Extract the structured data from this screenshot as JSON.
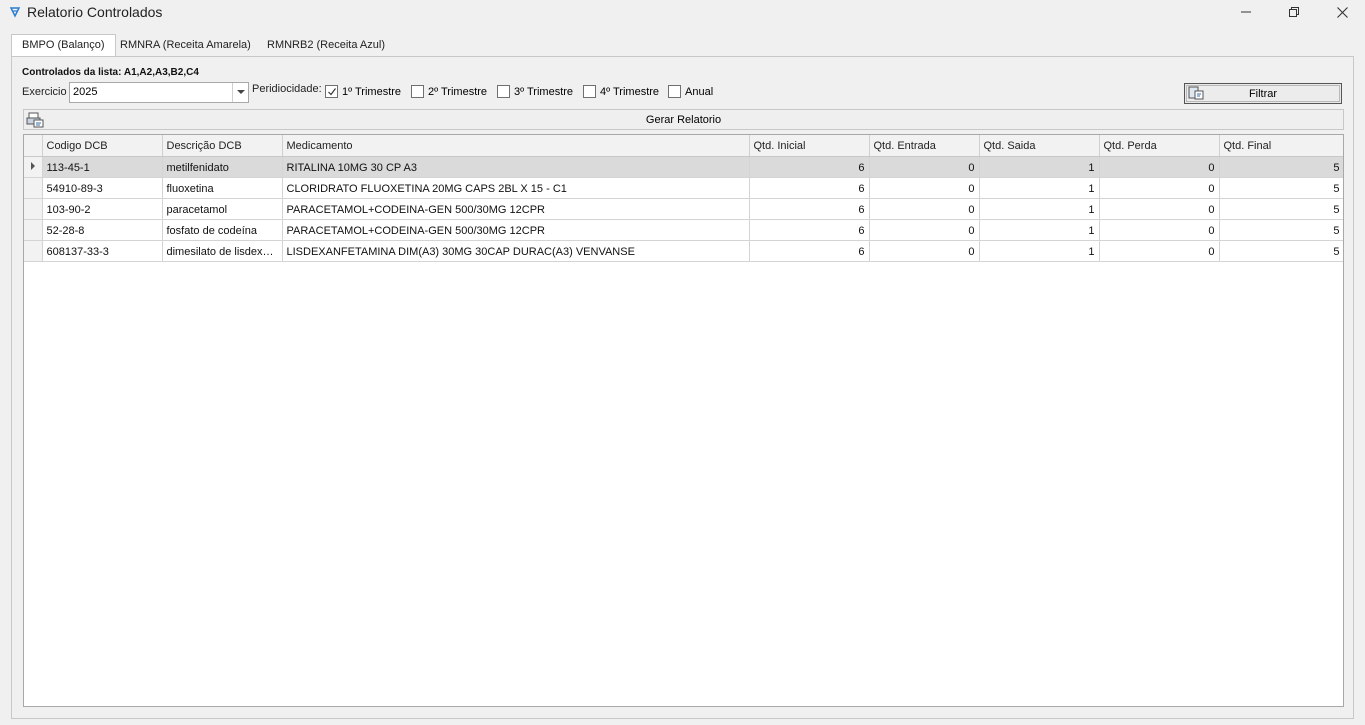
{
  "window": {
    "title": "Relatorio Controlados"
  },
  "tabs": [
    {
      "label": "BMPO (Balanço)",
      "active": true
    },
    {
      "label": "RMNRA (Receita Amarela)",
      "active": false
    },
    {
      "label": "RMNRB2 (Receita Azul)",
      "active": false
    }
  ],
  "form": {
    "list_heading": "Controlados da lista: A1,A2,A3,B2,C4",
    "exercicio_label": "Exercicio",
    "exercicio_value": "2025",
    "periodicidade_label": "Peridiocidade:",
    "periods": [
      {
        "label": "1º Trimestre",
        "checked": true
      },
      {
        "label": "2º Trimestre",
        "checked": false
      },
      {
        "label": "3º Trimestre",
        "checked": false
      },
      {
        "label": "4º Trimestre",
        "checked": false
      },
      {
        "label": "Anual",
        "checked": false
      }
    ],
    "filter_label": "Filtrar"
  },
  "report": {
    "generate_label": "Gerar Relatorio"
  },
  "grid": {
    "columns": [
      "Codigo DCB",
      "Descrição DCB",
      "Medicamento",
      "Qtd. Inicial",
      "Qtd. Entrada",
      "Qtd. Saida",
      "Qtd. Perda",
      "Qtd. Final"
    ],
    "rows": [
      {
        "codigo": "113-45-1",
        "descricao": "metilfenidato",
        "medicamento": "RITALINA 10MG 30 CP A3",
        "inicial": "6",
        "entrada": "0",
        "saida": "1",
        "perda": "0",
        "final": "5",
        "selected": true
      },
      {
        "codigo": "54910-89-3",
        "descricao": "fluoxetina",
        "medicamento": "CLORIDRATO FLUOXETINA 20MG CAPS 2BL X 15 - C1",
        "inicial": "6",
        "entrada": "0",
        "saida": "1",
        "perda": "0",
        "final": "5",
        "selected": false
      },
      {
        "codigo": "103-90-2",
        "descricao": "paracetamol",
        "medicamento": "PARACETAMOL+CODEINA-GEN 500/30MG 12CPR",
        "inicial": "6",
        "entrada": "0",
        "saida": "1",
        "perda": "0",
        "final": "5",
        "selected": false
      },
      {
        "codigo": "52-28-8",
        "descricao": "fosfato de codeína",
        "medicamento": "PARACETAMOL+CODEINA-GEN 500/30MG 12CPR",
        "inicial": "6",
        "entrada": "0",
        "saida": "1",
        "perda": "0",
        "final": "5",
        "selected": false
      },
      {
        "codigo": "608137-33-3",
        "descricao": "dimesilato de lisdexa...",
        "medicamento": "LISDEXANFETAMINA DIM(A3) 30MG 30CAP DURAC(A3) VENVANSE",
        "inicial": "6",
        "entrada": "0",
        "saida": "1",
        "perda": "0",
        "final": "5",
        "selected": false
      }
    ]
  }
}
